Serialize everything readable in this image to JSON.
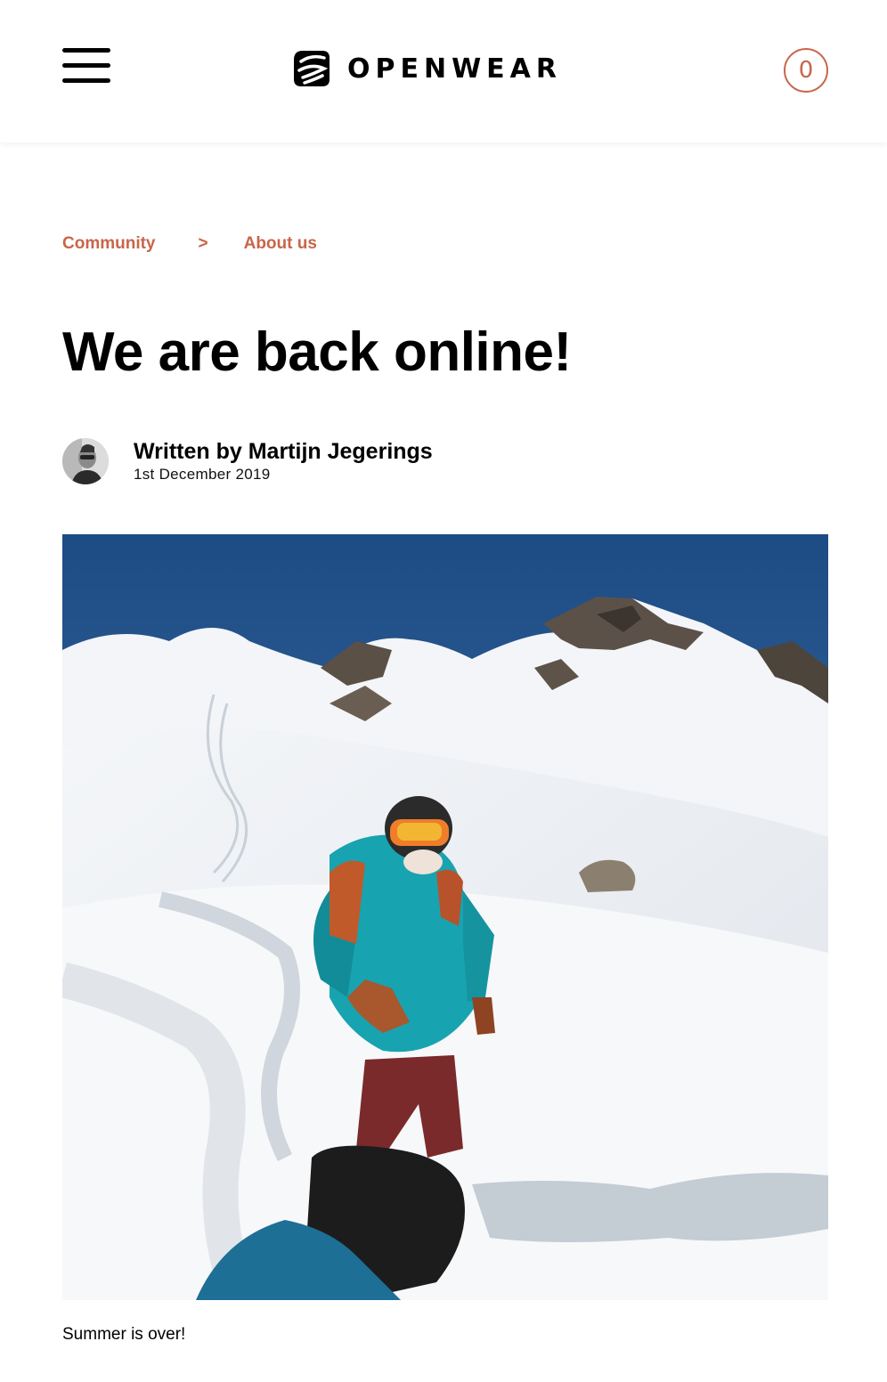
{
  "header": {
    "brand_name": "OPENWEAR",
    "cart_count": "0",
    "menu_icon": "hamburger-menu-icon",
    "logo_icon": "openwear-logo-icon"
  },
  "breadcrumb": {
    "items": [
      "Community",
      "About us"
    ],
    "separator": ">"
  },
  "article": {
    "title": "We are back online!",
    "author_line": "Written by Martijn Jegerings",
    "date": "1st December 2019",
    "caption": "Summer is over!"
  },
  "colors": {
    "accent": "#c8664a",
    "text": "#000000",
    "background": "#ffffff"
  }
}
